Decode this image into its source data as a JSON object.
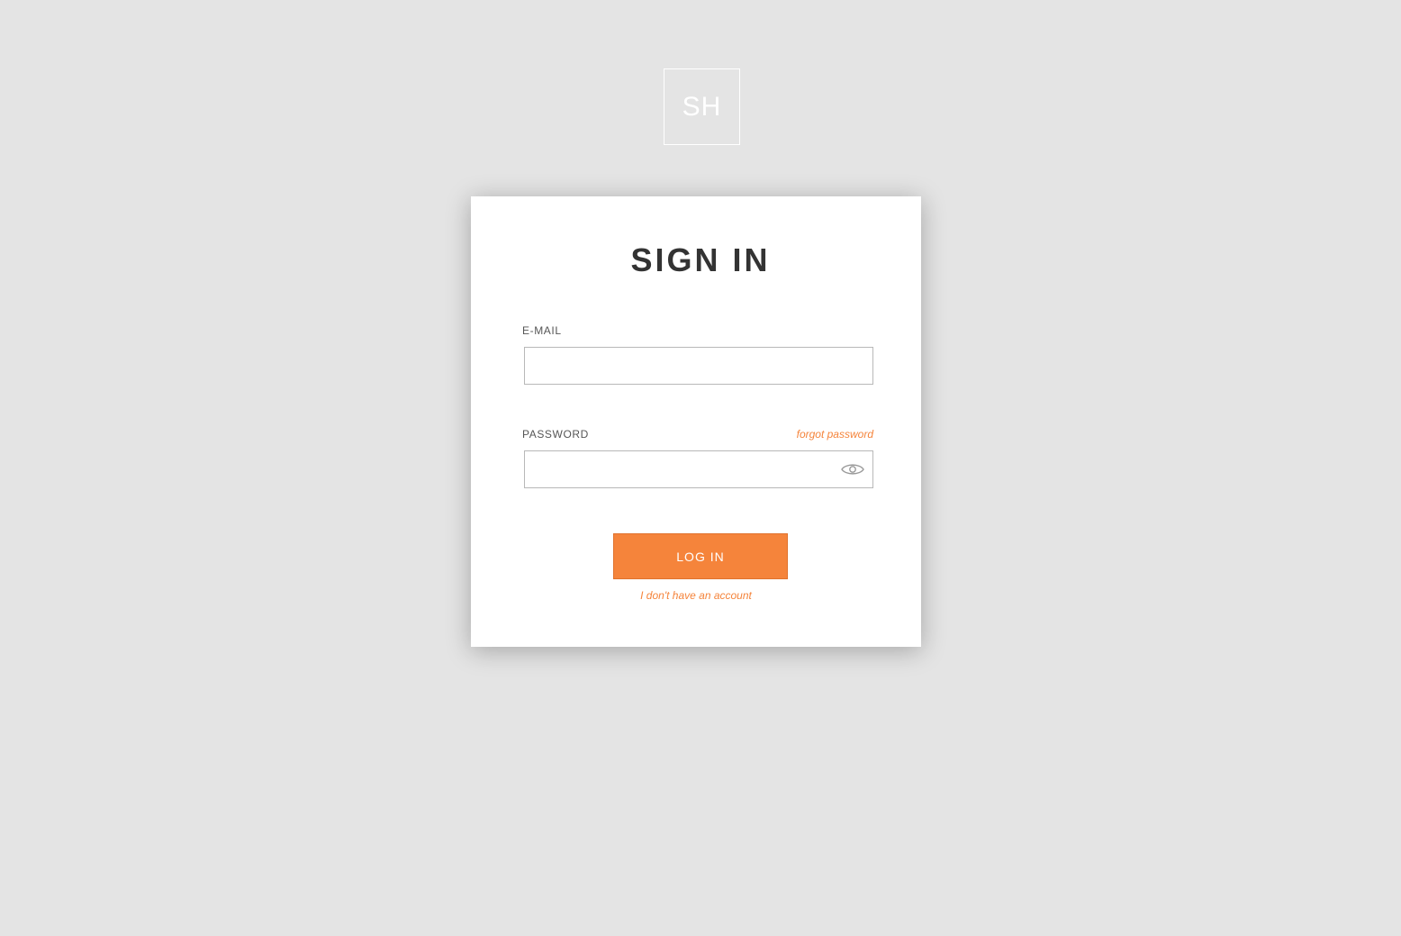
{
  "logo": {
    "text": "SH"
  },
  "form": {
    "title": "SIGN IN",
    "email_label": "E-MAIL",
    "email_value": "",
    "password_label": "PASSWORD",
    "password_value": "",
    "forgot_link": "forgot password",
    "login_button": "LOG IN",
    "no_account_link": "I don't have an account"
  },
  "icons": {
    "password_toggle": "eye-icon"
  },
  "colors": {
    "background": "#e4e4e4",
    "card": "#ffffff",
    "accent": "#f5843b",
    "title": "#333333",
    "field_border": "#b8b8b8"
  }
}
